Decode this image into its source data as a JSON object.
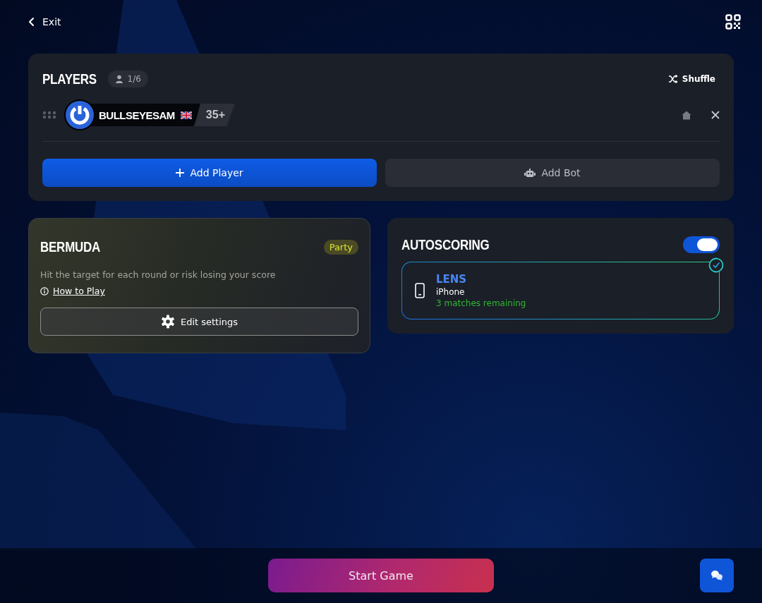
{
  "header": {
    "exit_label": "Exit"
  },
  "players": {
    "title": "PLAYERS",
    "count": "1/6",
    "shuffle_label": "Shuffle",
    "list": [
      {
        "name": "BULLSEYESAM",
        "badge": "35+"
      }
    ],
    "add_player_label": "Add Player",
    "add_bot_label": "Add Bot"
  },
  "game": {
    "title": "BERMUDA",
    "tag": "Party",
    "description": "Hit the target for each round or risk losing your score",
    "how_to_play": "How to Play",
    "edit_settings": "Edit settings"
  },
  "autoscoring": {
    "title": "AUTOSCORING",
    "on": true,
    "device": {
      "name": "LENS",
      "model": "iPhone",
      "remaining": "3 matches remaining",
      "selected": true
    }
  },
  "footer": {
    "start_label": "Start Game"
  }
}
